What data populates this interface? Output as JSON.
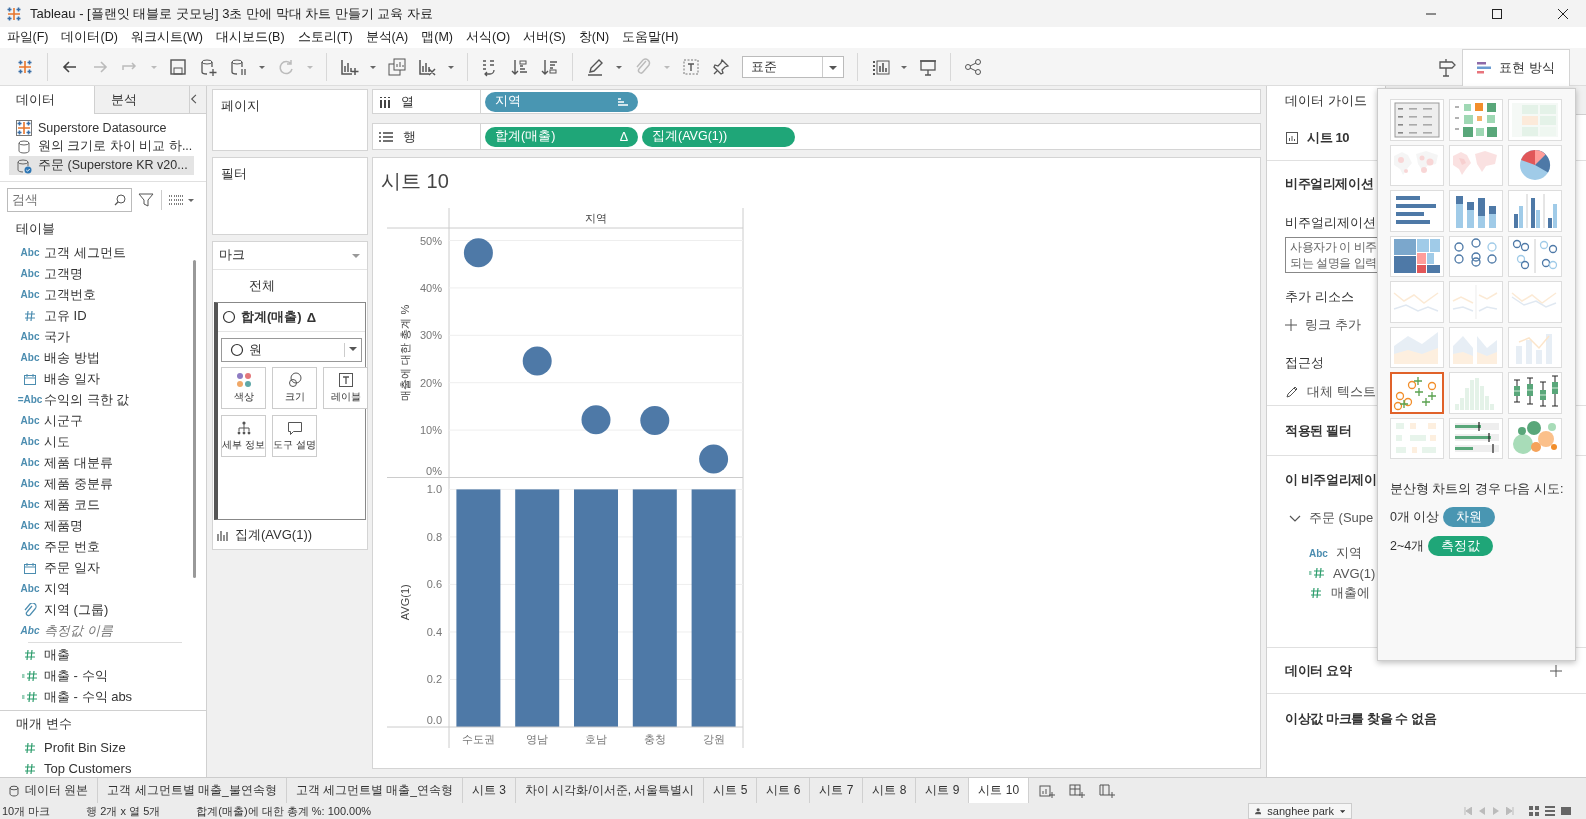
{
  "window": {
    "title": "Tableau - [플랜잇 태블로 굿모닝] 3초 만에 막대 차트 만들기 교육 자료"
  },
  "menu": [
    "파일(F)",
    "데이터(D)",
    "워크시트(W)",
    "대시보드(B)",
    "스토리(T)",
    "분석(A)",
    "맵(M)",
    "서식(O)",
    "서버(S)",
    "창(N)",
    "도움말(H)"
  ],
  "toolbar": {
    "fit_dropdown": "표준",
    "show_me_tab": {
      "label": "표현 방식",
      "selected": true
    }
  },
  "data_pane": {
    "tabs": [
      {
        "label": "데이터",
        "selected": true
      },
      {
        "label": "분석",
        "selected": false
      }
    ],
    "data_sources": [
      {
        "name": "Superstore Datasource",
        "kind": "extract",
        "selected": false
      },
      {
        "name": "원의 크기로 차이 비교 하...",
        "kind": "database",
        "selected": false
      },
      {
        "name": "주문 (Superstore KR v20...",
        "kind": "primary",
        "selected": true
      }
    ],
    "search": {
      "placeholder": "검색"
    },
    "tables_heading": "테이블",
    "fields": [
      {
        "icon": "Abc",
        "name": "고객 세그먼트",
        "kind": "string",
        "italic": false
      },
      {
        "icon": "Abc",
        "name": "고객명",
        "kind": "string",
        "italic": false
      },
      {
        "icon": "Abc",
        "name": "고객번호",
        "kind": "string",
        "italic": false
      },
      {
        "name": "고유 ID",
        "kind": "number",
        "italic": false
      },
      {
        "icon": "Abc",
        "name": "국가",
        "kind": "string",
        "italic": false
      },
      {
        "icon": "Abc",
        "name": "배송 방법",
        "kind": "string",
        "italic": false
      },
      {
        "name": "배송 일자",
        "kind": "date",
        "italic": false
      },
      {
        "icon": "=Abc",
        "name": "수익의 극한 값",
        "kind": "calc-string",
        "italic": false
      },
      {
        "icon": "Abc",
        "name": "시군구",
        "kind": "string",
        "italic": false
      },
      {
        "icon": "Abc",
        "name": "시도",
        "kind": "string",
        "italic": false
      },
      {
        "icon": "Abc",
        "name": "제품 대분류",
        "kind": "string",
        "italic": false
      },
      {
        "icon": "Abc",
        "name": "제품 중분류",
        "kind": "string",
        "italic": false
      },
      {
        "icon": "Abc",
        "name": "제품 코드",
        "kind": "string",
        "italic": false
      },
      {
        "icon": "Abc",
        "name": "제품명",
        "kind": "string",
        "italic": false
      },
      {
        "icon": "Abc",
        "name": "주문 번호",
        "kind": "string",
        "italic": false
      },
      {
        "name": "주문 일자",
        "kind": "date",
        "italic": false
      },
      {
        "icon": "Abc",
        "name": "지역",
        "kind": "string",
        "italic": false
      },
      {
        "name": "지역 (그룹)",
        "kind": "group",
        "italic": false
      },
      {
        "icon": "Abc",
        "name": "측정값 이름",
        "kind": "string",
        "italic": true
      }
    ],
    "measures": [
      {
        "name": "매출",
        "kind": "number",
        "italic": false
      },
      {
        "name": "매출 - 수익",
        "kind": "calc-number",
        "italic": false
      },
      {
        "name": "매출 - 수익 abs",
        "kind": "calc-number",
        "italic": false
      }
    ],
    "parameters_heading": "매개 변수",
    "parameters": [
      {
        "name": "Profit Bin Size",
        "kind": "number",
        "italic": false
      },
      {
        "name": "Top Customers",
        "kind": "number",
        "italic": false
      }
    ]
  },
  "cards": {
    "pages": "페이지",
    "filters": "필터",
    "marks": {
      "title": "마크",
      "all": "전체",
      "active_card": {
        "label": "합계(매출)",
        "badge": "Δ"
      },
      "mark_type": "원",
      "buttons": [
        {
          "label": "색상",
          "kind": "color"
        },
        {
          "label": "크기",
          "kind": "size"
        },
        {
          "label": "레이블",
          "kind": "label"
        },
        {
          "label": "세부 정보",
          "kind": "detail"
        },
        {
          "label": "도구 설명",
          "kind": "tooltip"
        }
      ],
      "second_card": "집계(AVG(1))"
    }
  },
  "shelves": {
    "columns": {
      "label": "열",
      "pills": [
        {
          "label": "지역",
          "kind": "dimension",
          "sorted": true
        }
      ]
    },
    "rows": {
      "label": "행",
      "pills": [
        {
          "label": "합계(매출)",
          "badge": "Δ",
          "kind": "measure",
          "sorted": false
        },
        {
          "label": "집계(AVG(1))",
          "kind": "measure",
          "sorted": false
        }
      ]
    }
  },
  "sheet": {
    "title": "시트 10",
    "panes": [
      {
        "chart_data": {
          "type": "scatter",
          "grid": true,
          "xlabel": "지역",
          "ylabel": "매출에 대한 총계 %",
          "values": [
            0.474,
            0.246,
            0.122,
            0.12,
            0.039
          ],
          "ylim": [
            0,
            0.5
          ],
          "yticks": [
            {
              "value": 0,
              "label": "0%"
            },
            {
              "value": 0.1,
              "label": "10%"
            },
            {
              "value": 0.2,
              "label": "20%"
            },
            {
              "value": 0.3,
              "label": "30%"
            },
            {
              "value": 0.4,
              "label": "40%"
            },
            {
              "value": 0.5,
              "label": "50%"
            }
          ]
        }
      },
      {
        "chart_data": {
          "type": "bar",
          "grid": true,
          "ylabel": "AVG(1)",
          "categories": [
            "수도권",
            "영남",
            "호남",
            "충청",
            "강원"
          ],
          "values": [
            1,
            1,
            1,
            1,
            1
          ],
          "ylim": [
            0,
            1
          ],
          "yticks": [
            {
              "value": 0,
              "label": "0.0"
            },
            {
              "value": 0.2,
              "label": "0.2"
            },
            {
              "value": 0.4,
              "label": "0.4"
            },
            {
              "value": 0.6,
              "label": "0.6"
            },
            {
              "value": 0.8,
              "label": "0.8"
            },
            {
              "value": 1,
              "label": "1.0"
            }
          ]
        }
      }
    ]
  },
  "guide": {
    "tab": "데이터 가이드",
    "sheet": "시트 10",
    "viz_heading": "비주얼리제이션",
    "description_label": "비주얼리제이션",
    "description_field": {
      "placeholder": "사용자가 이 비주\n되는 설명을 입력"
    },
    "resources_heading": "추가 리소스",
    "add_link": "링크 추가",
    "accessibility_heading": "접근성",
    "alt_text": "대체 텍스트",
    "filters_heading": "적용된 필터",
    "fields_heading": "이 비주얼리제이",
    "source": {
      "name": "주문 (Supe",
      "expanded": true
    },
    "fields": [
      {
        "icon": "Abc",
        "name": "지역",
        "kind": "string"
      },
      {
        "name": "AVG(1)",
        "kind": "calc-number"
      },
      {
        "name": "매출에",
        "kind": "number"
      }
    ],
    "summary_heading": "데이터 요약",
    "outliers": "이상값 마크를 찾을 수 없음"
  },
  "show_me": {
    "chart_types": [
      {
        "kind": "text-table",
        "selected": false,
        "available": true
      },
      {
        "kind": "heat-map",
        "selected": false,
        "available": true
      },
      {
        "kind": "highlight-table",
        "selected": false,
        "available": false
      },
      {
        "kind": "symbol-map",
        "selected": false,
        "available": false
      },
      {
        "kind": "filled-map",
        "selected": false,
        "available": false
      },
      {
        "kind": "pie-chart",
        "selected": false,
        "available": true
      },
      {
        "kind": "horizontal-bar",
        "selected": false,
        "available": true
      },
      {
        "kind": "stacked-bar",
        "selected": false,
        "available": true
      },
      {
        "kind": "side-by-side-bar",
        "selected": false,
        "available": true
      },
      {
        "kind": "treemap",
        "selected": false,
        "available": true
      },
      {
        "kind": "circle-view",
        "selected": false,
        "available": true
      },
      {
        "kind": "side-by-side-circle",
        "selected": false,
        "available": true
      },
      {
        "kind": "line-chart",
        "selected": false,
        "available": false
      },
      {
        "kind": "discrete-line",
        "selected": false,
        "available": false
      },
      {
        "kind": "dual-line",
        "selected": false,
        "available": false
      },
      {
        "kind": "area-chart",
        "selected": false,
        "available": false
      },
      {
        "kind": "discrete-area",
        "selected": false,
        "available": false
      },
      {
        "kind": "dual-combination",
        "selected": false,
        "available": false
      },
      {
        "kind": "scatter-plot",
        "selected": true,
        "available": true
      },
      {
        "kind": "histogram",
        "selected": false,
        "available": false
      },
      {
        "kind": "box-plot",
        "selected": false,
        "available": true
      },
      {
        "kind": "gantt-chart",
        "selected": false,
        "available": false
      },
      {
        "kind": "bullet-graph",
        "selected": false,
        "available": true
      },
      {
        "kind": "packed-bubbles",
        "selected": false,
        "available": true
      }
    ],
    "hint": "분산형 차트의 경우 다음 시도:",
    "requirements": [
      {
        "count": "0개 이상",
        "pill": "차원",
        "kind": "dimension"
      },
      {
        "count": "2~4개",
        "pill": "측정값",
        "kind": "measure"
      }
    ]
  },
  "sheet_tabs": [
    {
      "label": "데이터 원본",
      "kind": "datasource",
      "selected": false
    },
    {
      "label": "고객 세그먼트별 매출_불연속형",
      "kind": "sheet",
      "selected": false
    },
    {
      "label": "고객 세그먼트별 매출_연속형",
      "kind": "sheet",
      "selected": false
    },
    {
      "label": "시트 3",
      "kind": "sheet",
      "selected": false
    },
    {
      "label": "차이 시각화/이서준, 서울특별시",
      "kind": "sheet",
      "selected": false
    },
    {
      "label": "시트 5",
      "kind": "sheet",
      "selected": false
    },
    {
      "label": "시트 6",
      "kind": "sheet",
      "selected": false
    },
    {
      "label": "시트 7",
      "kind": "sheet",
      "selected": false
    },
    {
      "label": "시트 8",
      "kind": "sheet",
      "selected": false
    },
    {
      "label": "시트 9",
      "kind": "sheet",
      "selected": false
    },
    {
      "label": "시트 10",
      "kind": "sheet",
      "selected": true
    }
  ],
  "status_bar": {
    "marks": "10개 마크",
    "dimensions": "행 2개 x 열 5개",
    "summary": "합계(매출)에 대한 총계 %: 100.00%",
    "user": "sanghee park"
  }
}
